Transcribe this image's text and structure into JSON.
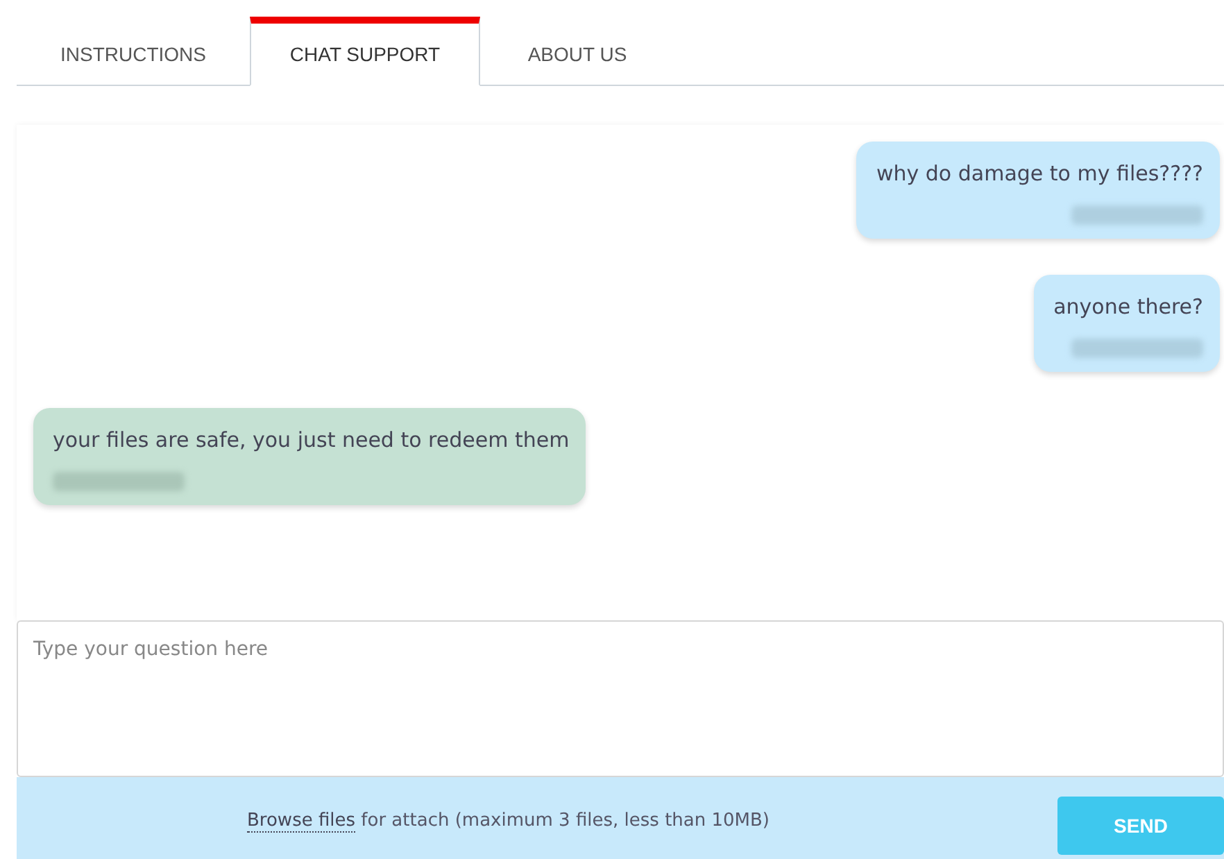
{
  "tabs": [
    {
      "label": "INSTRUCTIONS",
      "selected": false
    },
    {
      "label": "CHAT SUPPORT",
      "selected": true
    },
    {
      "label": "ABOUT US",
      "selected": false
    }
  ],
  "messages": [
    {
      "kind": "outgoing",
      "text": "why do damage to my files????"
    },
    {
      "kind": "outgoing",
      "text": "anyone there?"
    },
    {
      "kind": "incoming",
      "text": "your files are safe, you just need to redeem them"
    }
  ],
  "question": {
    "placeholder": "Type your question here"
  },
  "attach": {
    "link": "Browse files",
    "text": " for attach (maximum 3 files, less than 10MB)"
  },
  "send_button": "SEND"
}
